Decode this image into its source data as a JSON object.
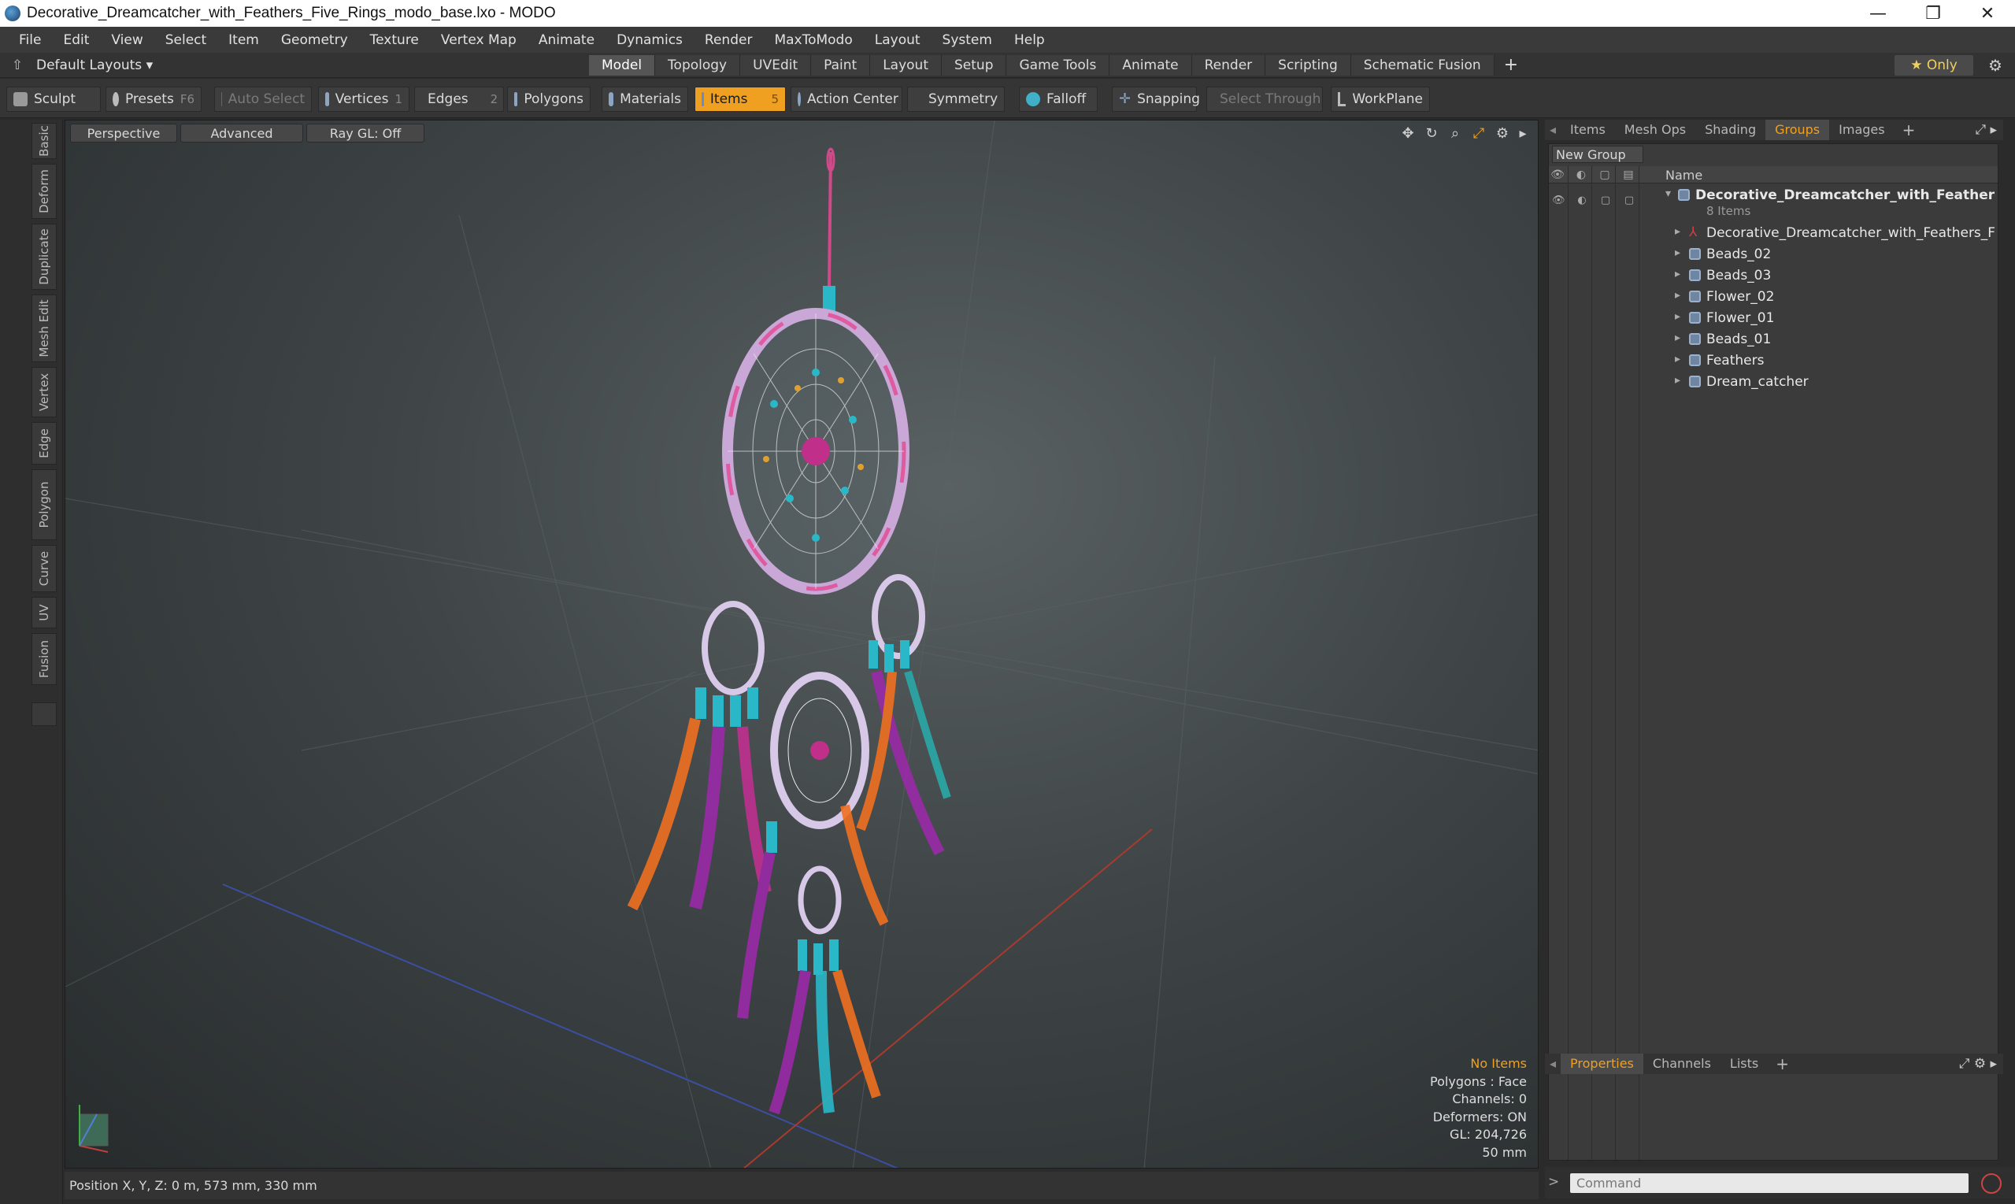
{
  "window": {
    "title": "Decorative_Dreamcatcher_with_Feathers_Five_Rings_modo_base.lxo - MODO",
    "minimize": "—",
    "maximize": "❐",
    "close": "✕"
  },
  "menu": [
    "File",
    "Edit",
    "View",
    "Select",
    "Item",
    "Geometry",
    "Texture",
    "Vertex Map",
    "Animate",
    "Dynamics",
    "Render",
    "MaxToModo",
    "Layout",
    "System",
    "Help"
  ],
  "layout_bar": {
    "layouts": "Default Layouts ▾",
    "tabs": [
      "Model",
      "Topology",
      "UVEdit",
      "Paint",
      "Layout",
      "Setup",
      "Game Tools",
      "Animate",
      "Render",
      "Scripting",
      "Schematic Fusion"
    ],
    "active_tab": "Model",
    "only": "★  Only"
  },
  "toolbar": {
    "sculpt": "Sculpt",
    "presets": "Presets",
    "presets_key": "F6",
    "auto_select": "Auto Select",
    "vertices": "Vertices",
    "vertices_count": "1",
    "edges": "Edges",
    "edges_count": "2",
    "polygons": "Polygons",
    "materials": "Materials",
    "items": "Items",
    "items_count": "5",
    "action_center": "Action Center",
    "symmetry": "Symmetry",
    "falloff": "Falloff",
    "snapping": "Snapping",
    "select_through": "Select Through",
    "workplane": "WorkPlane"
  },
  "left_tabs": [
    "Basic",
    "Deform",
    "Duplicate",
    "Mesh Edit",
    "Vertex",
    "Edge",
    "Polygon",
    "Curve",
    "UV",
    "Fusion"
  ],
  "viewport": {
    "perspective": "Perspective",
    "advanced": "Advanced",
    "raygl": "Ray GL: Off",
    "stats": {
      "no_items": "No Items",
      "polygons": "Polygons : Face",
      "channels": "Channels: 0",
      "deformers": "Deformers: ON",
      "gl": "GL: 204,726",
      "size": "50 mm"
    }
  },
  "status": {
    "position": "Position X, Y, Z:   0 m, 573 mm, 330 mm"
  },
  "panel_tabs": [
    "Items",
    "Mesh Ops",
    "Shading",
    "Groups",
    "Images"
  ],
  "panel_active": "Groups",
  "groups": {
    "new_group": "New Group",
    "name_header": "Name",
    "root": {
      "name": "Decorative_Dreamcatcher_with_Feathers...",
      "sub": "8 Items"
    },
    "items": [
      "Decorative_Dreamcatcher_with_Feathers_Five ...",
      "Beads_02",
      "Beads_03",
      "Flower_02",
      "Flower_01",
      "Beads_01",
      "Feathers",
      "Dream_catcher"
    ]
  },
  "bottom_tabs": [
    "Properties",
    "Channels",
    "Lists"
  ],
  "bottom_active": "Properties",
  "command": {
    "prompt": ">",
    "placeholder": "Command"
  },
  "colors": {
    "accent": "#f0a020",
    "panel": "#3b3b3b",
    "background": "#2b2b2b"
  }
}
